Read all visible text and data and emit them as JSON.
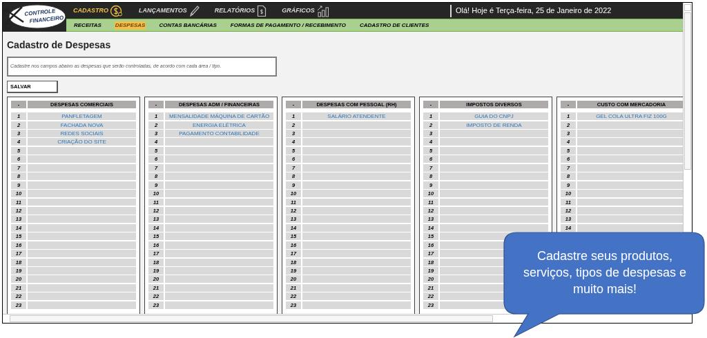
{
  "logo": {
    "line1": "CONTROLE",
    "line2": "FINANCEIRO"
  },
  "top_nav": [
    {
      "label": "CADASTRO",
      "selected": true,
      "kind": "coin"
    },
    {
      "label": "LANÇAMENTOS",
      "selected": false,
      "kind": "pencil"
    },
    {
      "label": "RELATÓRIOS",
      "selected": false,
      "kind": "document"
    },
    {
      "label": "GRÁFICOS",
      "selected": false,
      "kind": "chart"
    }
  ],
  "greeting": "Olá! Hoje é Terça-feira, 25 de Janeiro de 2022",
  "sub_nav": [
    {
      "label": "RECEITAS",
      "selected": false
    },
    {
      "label": "DESPESAS",
      "selected": true
    },
    {
      "label": "CONTAS BANCÁRIAS",
      "selected": false
    },
    {
      "label": "FORMAS DE PAGAMENTO / RECEBIMENTO",
      "selected": false
    },
    {
      "label": "CADASTRO DE CLIENTES",
      "selected": false
    }
  ],
  "page_title": "Cadastro de Despesas",
  "description": "Cadastre nos campos abaixo as despesas que serão controladas, de acordo com cada área / tipo.",
  "save_button": "SALVAR",
  "panels": [
    {
      "index_header": "-",
      "title": "DESPESAS COMERCIAIS",
      "rows": [
        {
          "number": "1",
          "value": "PANFLETAGEM"
        },
        {
          "number": "2",
          "value": "FACHADA NOVA"
        },
        {
          "number": "3",
          "value": "REDES SOCIAIS"
        },
        {
          "number": "4",
          "value": "CRIAÇÃO DO SITE"
        },
        {
          "number": "5"
        },
        {
          "number": "6"
        },
        {
          "number": "7"
        },
        {
          "number": "8"
        },
        {
          "number": "9"
        },
        {
          "number": "10"
        },
        {
          "number": "11"
        },
        {
          "number": "12"
        },
        {
          "number": "13"
        },
        {
          "number": "14"
        },
        {
          "number": "15"
        },
        {
          "number": "16"
        },
        {
          "number": "17"
        },
        {
          "number": "18"
        },
        {
          "number": "19"
        },
        {
          "number": "20"
        },
        {
          "number": "21"
        },
        {
          "number": "22"
        },
        {
          "number": "23"
        }
      ]
    },
    {
      "index_header": "-",
      "title": "DESPESAS ADM / FINANCEIRAS",
      "rows": [
        {
          "number": "1",
          "value": "MENSALIDADE MÁQUINA DE CARTÃO"
        },
        {
          "number": "2",
          "value": "ENERGIA ELÉTRICA"
        },
        {
          "number": "3",
          "value": "PAGAMENTO CONTABILIDADE"
        },
        {
          "number": "4"
        },
        {
          "number": "5"
        },
        {
          "number": "6"
        },
        {
          "number": "7"
        },
        {
          "number": "8"
        },
        {
          "number": "9"
        },
        {
          "number": "10"
        },
        {
          "number": "11"
        },
        {
          "number": "12"
        },
        {
          "number": "13"
        },
        {
          "number": "14"
        },
        {
          "number": "15"
        },
        {
          "number": "16"
        },
        {
          "number": "17"
        },
        {
          "number": "18"
        },
        {
          "number": "19"
        },
        {
          "number": "20"
        },
        {
          "number": "21"
        },
        {
          "number": "22"
        },
        {
          "number": "23"
        }
      ]
    },
    {
      "index_header": "-",
      "title": "DESPESAS COM PESSOAL (RH)",
      "rows": [
        {
          "number": "1",
          "value": "SALÁRIO ATENDENTE"
        },
        {
          "number": "2"
        },
        {
          "number": "3"
        },
        {
          "number": "4"
        },
        {
          "number": "5"
        },
        {
          "number": "6"
        },
        {
          "number": "7"
        },
        {
          "number": "8"
        },
        {
          "number": "9"
        },
        {
          "number": "10"
        },
        {
          "number": "11"
        },
        {
          "number": "12"
        },
        {
          "number": "13"
        },
        {
          "number": "14"
        },
        {
          "number": "15"
        },
        {
          "number": "16"
        },
        {
          "number": "17"
        },
        {
          "number": "18"
        },
        {
          "number": "19"
        },
        {
          "number": "20"
        },
        {
          "number": "21"
        },
        {
          "number": "22"
        },
        {
          "number": "23"
        }
      ]
    },
    {
      "index_header": "-",
      "title": "IMPOSTOS DIVERSOS",
      "rows": [
        {
          "number": "1",
          "value": "GUIA DO CNPJ"
        },
        {
          "number": "2",
          "value": "IMPOSTO DE RENDA"
        },
        {
          "number": "3"
        },
        {
          "number": "4"
        },
        {
          "number": "5"
        },
        {
          "number": "6"
        },
        {
          "number": "7"
        },
        {
          "number": "8"
        },
        {
          "number": "9"
        },
        {
          "number": "10"
        },
        {
          "number": "11"
        },
        {
          "number": "12"
        },
        {
          "number": "13"
        },
        {
          "number": "14"
        },
        {
          "number": "15"
        },
        {
          "number": "16"
        },
        {
          "number": "17"
        },
        {
          "number": "18"
        },
        {
          "number": "19"
        },
        {
          "number": "20"
        },
        {
          "number": "21"
        },
        {
          "number": "22"
        },
        {
          "number": "23"
        }
      ]
    },
    {
      "index_header": "-",
      "title": "CUSTO COM MERCADORIA",
      "rows": [
        {
          "number": "1",
          "value": "GEL COLA ULTRA FIZ 100G"
        },
        {
          "number": "2"
        },
        {
          "number": "3"
        },
        {
          "number": "4"
        },
        {
          "number": "5"
        },
        {
          "number": "6"
        },
        {
          "number": "7"
        },
        {
          "number": "8"
        },
        {
          "number": "9"
        },
        {
          "number": "10"
        },
        {
          "number": "11"
        },
        {
          "number": "12"
        },
        {
          "number": "13"
        },
        {
          "number": "14"
        }
      ]
    }
  ],
  "callout": "Cadastre seus produtos, serviços, tipos de despesas e muito mais!"
}
